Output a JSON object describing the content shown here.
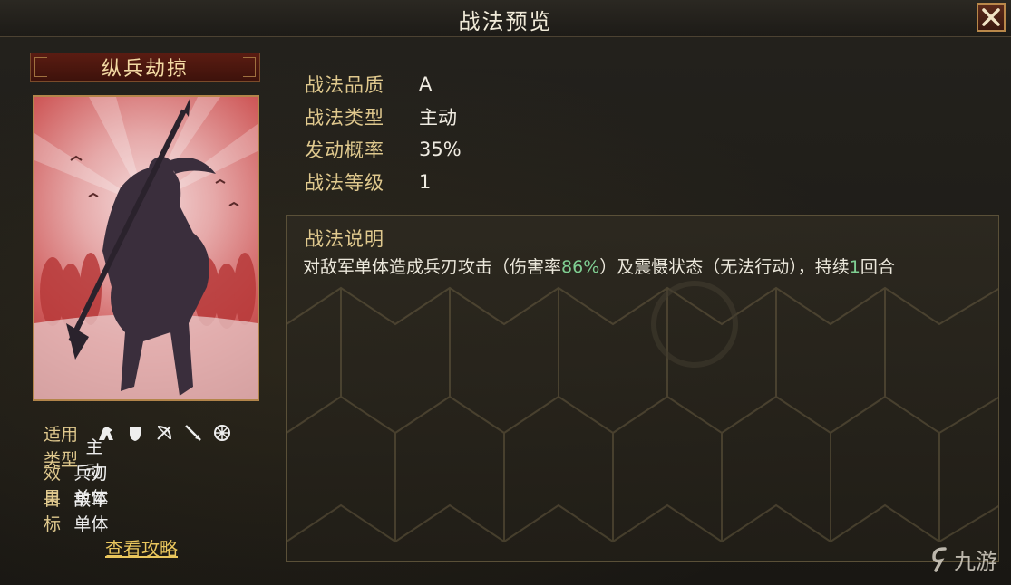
{
  "window": {
    "title": "战法预览"
  },
  "tactic": {
    "name": "纵兵劫掠",
    "stats": [
      {
        "label": "战法品质",
        "value": "A"
      },
      {
        "label": "战法类型",
        "value": "主动"
      },
      {
        "label": "发动概率",
        "value": "35%"
      },
      {
        "label": "战法等级",
        "value": "1"
      }
    ],
    "description": {
      "title": "战法说明",
      "text_before": "对敌军单体造成兵刃攻击（伤害率",
      "damage_rate": "86%",
      "text_middle": "）及震慑状态（无法行动），持续",
      "duration": "1",
      "text_after": "回合"
    }
  },
  "attributes": {
    "applicable_label": "适用",
    "applicable_icons": [
      "cavalry-icon",
      "shield-icon",
      "bow-icon",
      "spear-icon",
      "wheel-icon"
    ],
    "type_label": "类型",
    "type_value": "主动",
    "effect_label": "效果",
    "effect_value": "兵刃单体",
    "target_label": "目标",
    "target_value": "敌军单体"
  },
  "guide_link": "查看攻略",
  "watermark": "九游",
  "colors": {
    "label_gold": "#e0c98e",
    "highlight_green": "#7fcf92",
    "link_yellow": "#e9c65d",
    "banner_red": "#5a1c12"
  }
}
